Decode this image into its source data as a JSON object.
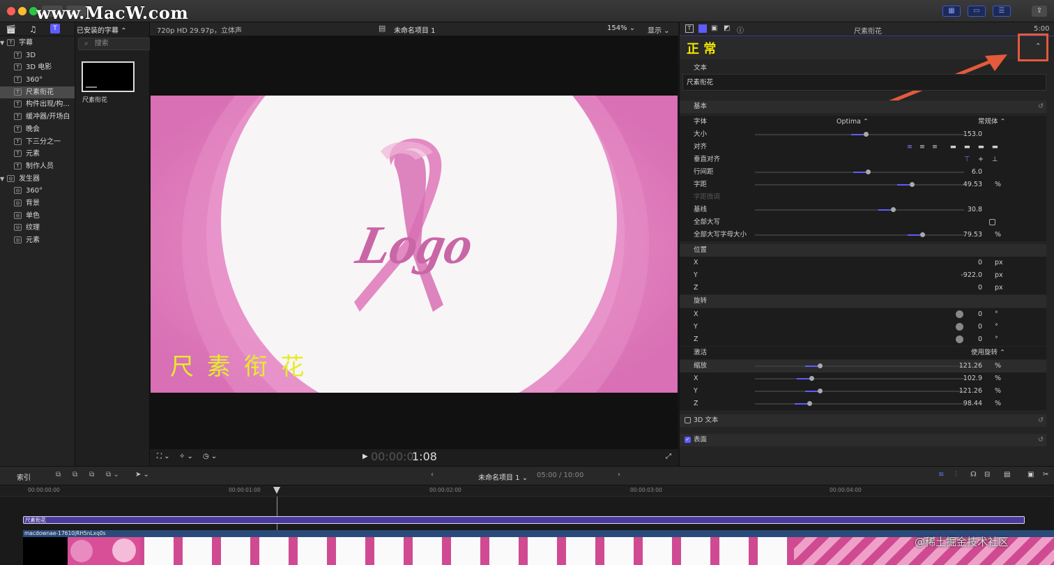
{
  "colors": {
    "accent": "#5d5dff",
    "title_yellow": "#f3e600",
    "arrow": "#e35a3c",
    "canvas_pink": "#e080bf",
    "clip_purple": "#4a3aa0"
  },
  "watermark": "www.MacW.com",
  "library": {
    "header": "已安装的字幕",
    "search_placeholder": "搜索",
    "groups": [
      {
        "label": "字幕",
        "items": [
          "3D",
          "3D 电影",
          "360°",
          "尺素衔花",
          "构件出现/构...",
          "缓冲器/开场白",
          "晚会",
          "下三分之一",
          "元素",
          "制作人员"
        ]
      },
      {
        "label": "发生器",
        "items": [
          "360°",
          "背景",
          "单色",
          "纹理",
          "元素"
        ]
      }
    ],
    "selected_item": "尺素衔花",
    "thumbnail_label": "尺素衔花"
  },
  "viewer": {
    "format": "720p HD 29.97p，立体声",
    "project": "未命名项目 1",
    "zoom": "154%",
    "display_menu": "显示",
    "timecode_dim": "00:00:0",
    "timecode": "1:08",
    "logo_text": "Logo",
    "overlay_text": "尺 素 衔 花"
  },
  "inspector": {
    "title": "尺素衔花",
    "timecode": "5:00",
    "preset": "正 常",
    "text_section": "文本",
    "text_value": "尺素衔花",
    "basic_section": "基本",
    "font_label": "字体",
    "font_value": "Optima",
    "font_style": "常规体",
    "size_label": "大小",
    "size_value": "153.0",
    "align_label": "对齐",
    "valign_label": "垂直对齐",
    "line_label": "行间距",
    "line_value": "6.0",
    "tracking_label": "字距",
    "tracking_value": "49.53",
    "tracking_unit": "%",
    "kerning_label": "字距微调",
    "baseline_label": "基线",
    "baseline_value": "30.8",
    "allcaps_label": "全部大写",
    "allcaps_size_label": "全部大写字母大小",
    "allcaps_size_value": "79.53",
    "allcaps_size_unit": "%",
    "position_label": "位置",
    "pos_x": "0",
    "pos_y": "-922.0",
    "pos_z": "0",
    "px": "px",
    "rotation_label": "旋转",
    "rot_x": "0",
    "rot_y": "0",
    "rot_z": "0",
    "deg": "°",
    "animate_label": "激活",
    "animate_value": "使用旋转",
    "scale_label": "缩放",
    "scale_value": "121.26",
    "scale_x": "102.9",
    "scale_y": "121.26",
    "scale_z": "98.44",
    "pct": "%",
    "x": "X",
    "y": "Y",
    "z": "Z",
    "text3d_label": "3D 文本",
    "surface_label": "表面",
    "size_level": 0.52,
    "line_level": 0.53,
    "tracking_level": 0.74,
    "baseline_level": 0.65,
    "allcaps_size_level": 0.79,
    "scale_level": 0.3,
    "scale_x_level": 0.26,
    "scale_y_level": 0.3,
    "scale_z_level": 0.25
  },
  "timeline": {
    "index_label": "索引",
    "project": "未命名项目 1",
    "duration": "05:00 / 10:00",
    "ruler": [
      "00:00:00:00",
      "00:00:01:00",
      "00:00:02:00",
      "00:00:03:00",
      "00:00:04:00"
    ],
    "title_clip": "尺素衔花",
    "video_clip": "macdownae-17610jRH5nLxq0s",
    "footer_watermark": "@稀土掘金技术社区"
  }
}
